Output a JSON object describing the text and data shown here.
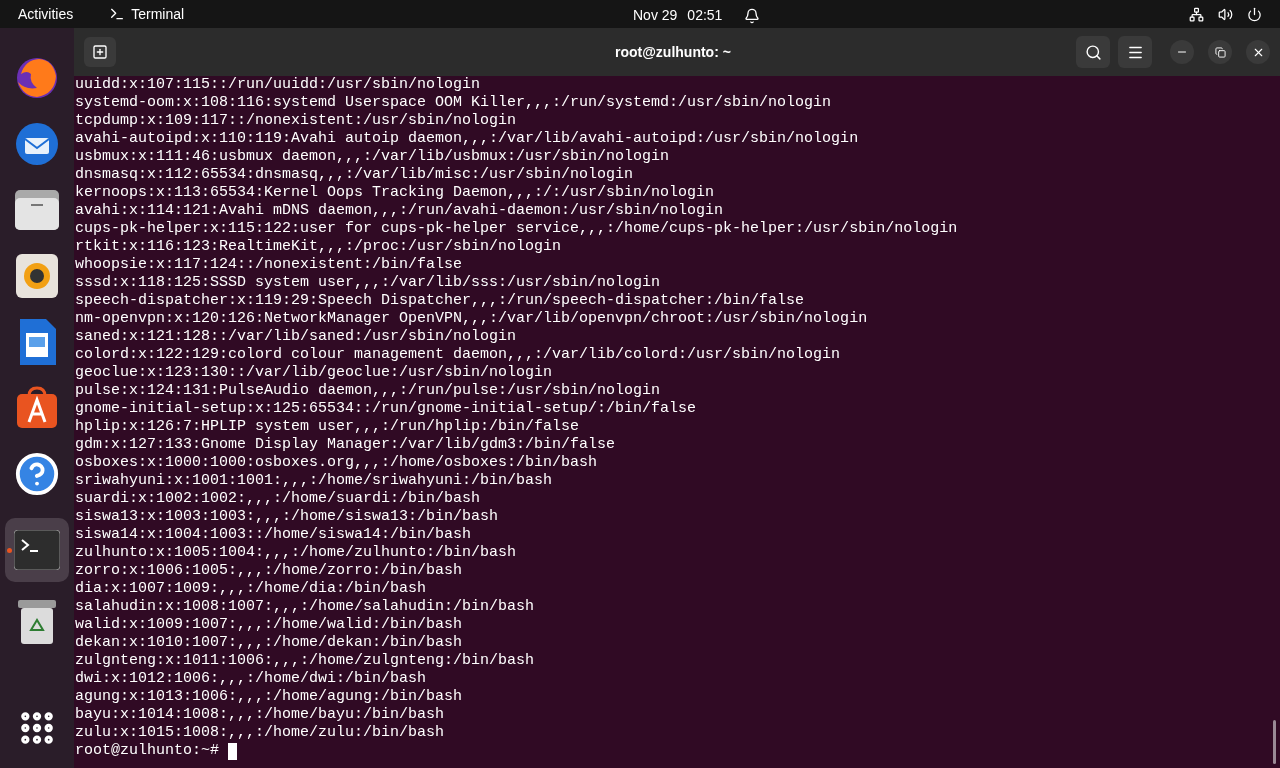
{
  "top_bar": {
    "activities": "Activities",
    "app_name": "Terminal",
    "date": "Nov 29",
    "time": "02:51"
  },
  "dock": {
    "items": [
      {
        "kind": "browser",
        "active": false
      },
      {
        "kind": "mail",
        "active": false
      },
      {
        "kind": "files",
        "active": false
      },
      {
        "kind": "music",
        "active": false
      },
      {
        "kind": "document",
        "active": false
      },
      {
        "kind": "store",
        "active": false
      },
      {
        "kind": "help",
        "active": false
      },
      {
        "kind": "terminal",
        "active": true
      },
      {
        "kind": "trash",
        "active": false
      }
    ]
  },
  "window": {
    "title": "root@zulhunto: ~"
  },
  "terminal": {
    "lines": [
      "uuidd:x:107:115::/run/uuidd:/usr/sbin/nologin",
      "systemd-oom:x:108:116:systemd Userspace OOM Killer,,,:/run/systemd:/usr/sbin/nologin",
      "tcpdump:x:109:117::/nonexistent:/usr/sbin/nologin",
      "avahi-autoipd:x:110:119:Avahi autoip daemon,,,:/var/lib/avahi-autoipd:/usr/sbin/nologin",
      "usbmux:x:111:46:usbmux daemon,,,:/var/lib/usbmux:/usr/sbin/nologin",
      "dnsmasq:x:112:65534:dnsmasq,,,:/var/lib/misc:/usr/sbin/nologin",
      "kernoops:x:113:65534:Kernel Oops Tracking Daemon,,,:/:/usr/sbin/nologin",
      "avahi:x:114:121:Avahi mDNS daemon,,,:/run/avahi-daemon:/usr/sbin/nologin",
      "cups-pk-helper:x:115:122:user for cups-pk-helper service,,,:/home/cups-pk-helper:/usr/sbin/nologin",
      "rtkit:x:116:123:RealtimeKit,,,:/proc:/usr/sbin/nologin",
      "whoopsie:x:117:124::/nonexistent:/bin/false",
      "sssd:x:118:125:SSSD system user,,,:/var/lib/sss:/usr/sbin/nologin",
      "speech-dispatcher:x:119:29:Speech Dispatcher,,,:/run/speech-dispatcher:/bin/false",
      "nm-openvpn:x:120:126:NetworkManager OpenVPN,,,:/var/lib/openvpn/chroot:/usr/sbin/nologin",
      "saned:x:121:128::/var/lib/saned:/usr/sbin/nologin",
      "colord:x:122:129:colord colour management daemon,,,:/var/lib/colord:/usr/sbin/nologin",
      "geoclue:x:123:130::/var/lib/geoclue:/usr/sbin/nologin",
      "pulse:x:124:131:PulseAudio daemon,,,:/run/pulse:/usr/sbin/nologin",
      "gnome-initial-setup:x:125:65534::/run/gnome-initial-setup/:/bin/false",
      "hplip:x:126:7:HPLIP system user,,,:/run/hplip:/bin/false",
      "gdm:x:127:133:Gnome Display Manager:/var/lib/gdm3:/bin/false",
      "osboxes:x:1000:1000:osboxes.org,,,:/home/osboxes:/bin/bash",
      "sriwahyuni:x:1001:1001:,,,:/home/sriwahyuni:/bin/bash",
      "suardi:x:1002:1002:,,,:/home/suardi:/bin/bash",
      "siswa13:x:1003:1003:,,,:/home/siswa13:/bin/bash",
      "siswa14:x:1004:1003::/home/siswa14:/bin/bash",
      "zulhunto:x:1005:1004:,,,:/home/zulhunto:/bin/bash",
      "zorro:x:1006:1005:,,,:/home/zorro:/bin/bash",
      "dia:x:1007:1009:,,,:/home/dia:/bin/bash",
      "salahudin:x:1008:1007:,,,:/home/salahudin:/bin/bash",
      "walid:x:1009:1007:,,,:/home/walid:/bin/bash",
      "dekan:x:1010:1007:,,,:/home/dekan:/bin/bash",
      "zulgnteng:x:1011:1006:,,,:/home/zulgnteng:/bin/bash",
      "dwi:x:1012:1006:,,,:/home/dwi:/bin/bash",
      "agung:x:1013:1006:,,,:/home/agung:/bin/bash",
      "bayu:x:1014:1008:,,,:/home/bayu:/bin/bash",
      "zulu:x:1015:1008:,,,:/home/zulu:/bin/bash"
    ],
    "prompt": "root@zulhunto:~#"
  }
}
